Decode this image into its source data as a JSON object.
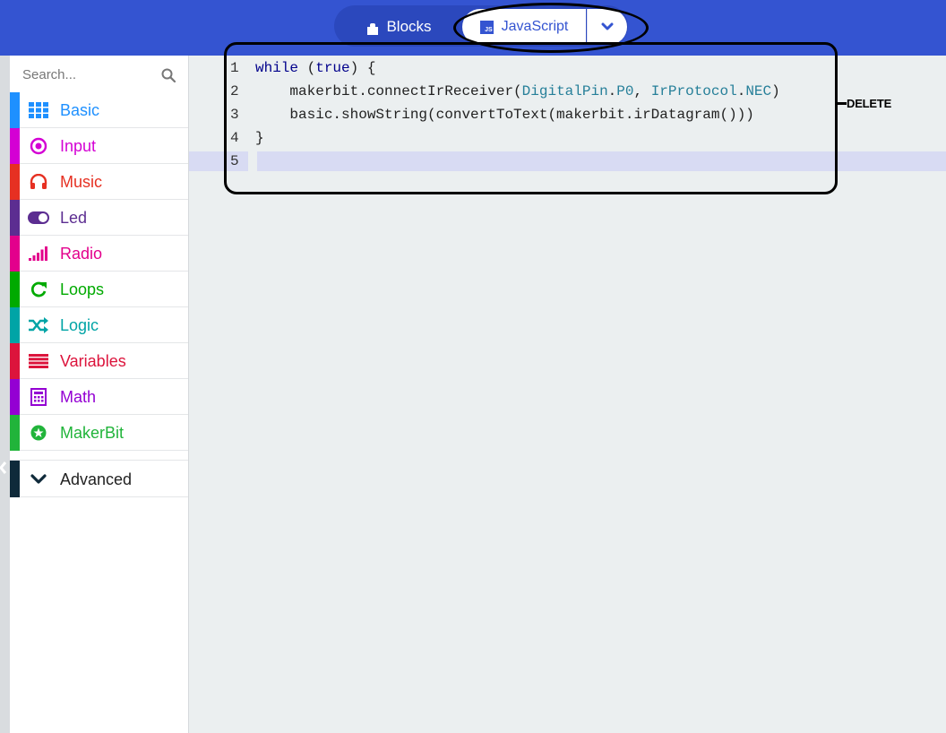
{
  "header": {
    "blocks_label": "Blocks",
    "javascript_label": "JavaScript",
    "js_badge": "JS",
    "background_color": "#3454d1"
  },
  "toolbox": {
    "search_placeholder": "Search...",
    "categories": [
      {
        "label": "Basic",
        "color": "#1e90ff",
        "icon": "grid-icon"
      },
      {
        "label": "Input",
        "color": "#d400d4",
        "icon": "target-icon"
      },
      {
        "label": "Music",
        "color": "#e63022",
        "icon": "headphones-icon"
      },
      {
        "label": "Led",
        "color": "#5c2d91",
        "icon": "toggle-icon"
      },
      {
        "label": "Radio",
        "color": "#e3008c",
        "icon": "signal-bars-icon"
      },
      {
        "label": "Loops",
        "color": "#00aa00",
        "icon": "refresh-icon"
      },
      {
        "label": "Logic",
        "color": "#00a4a6",
        "icon": "shuffle-icon"
      },
      {
        "label": "Variables",
        "color": "#dc143c",
        "icon": "list-lines-icon"
      },
      {
        "label": "Math",
        "color": "#9400d3",
        "icon": "calculator-icon"
      },
      {
        "label": "MakerBit",
        "color": "#21b43a",
        "icon": "star-circle-icon"
      }
    ],
    "advanced": {
      "label": "Advanced",
      "color": "#0f2a3a",
      "icon": "chevron-down-icon"
    }
  },
  "editor": {
    "line_numbers": [
      "1",
      "2",
      "3",
      "4",
      "5"
    ],
    "lines": {
      "l1_kw": "while",
      "l1_a": " (",
      "l1_kw2": "true",
      "l1_b": ") {",
      "l2_indent": "    ",
      "l2_a": "makerbit.connectIrReceiver(",
      "l2_ty1": "DigitalPin",
      "l2_b": ".",
      "l2_ty2": "P0",
      "l2_c": ", ",
      "l2_ty3": "IrProtocol",
      "l2_d": ".",
      "l2_ty4": "NEC",
      "l2_e": ")",
      "l3": "    basic.showString(convertToText(makerbit.irDatagram()))",
      "l4": "}"
    }
  },
  "annotation": {
    "delete_label": "DELETE"
  }
}
